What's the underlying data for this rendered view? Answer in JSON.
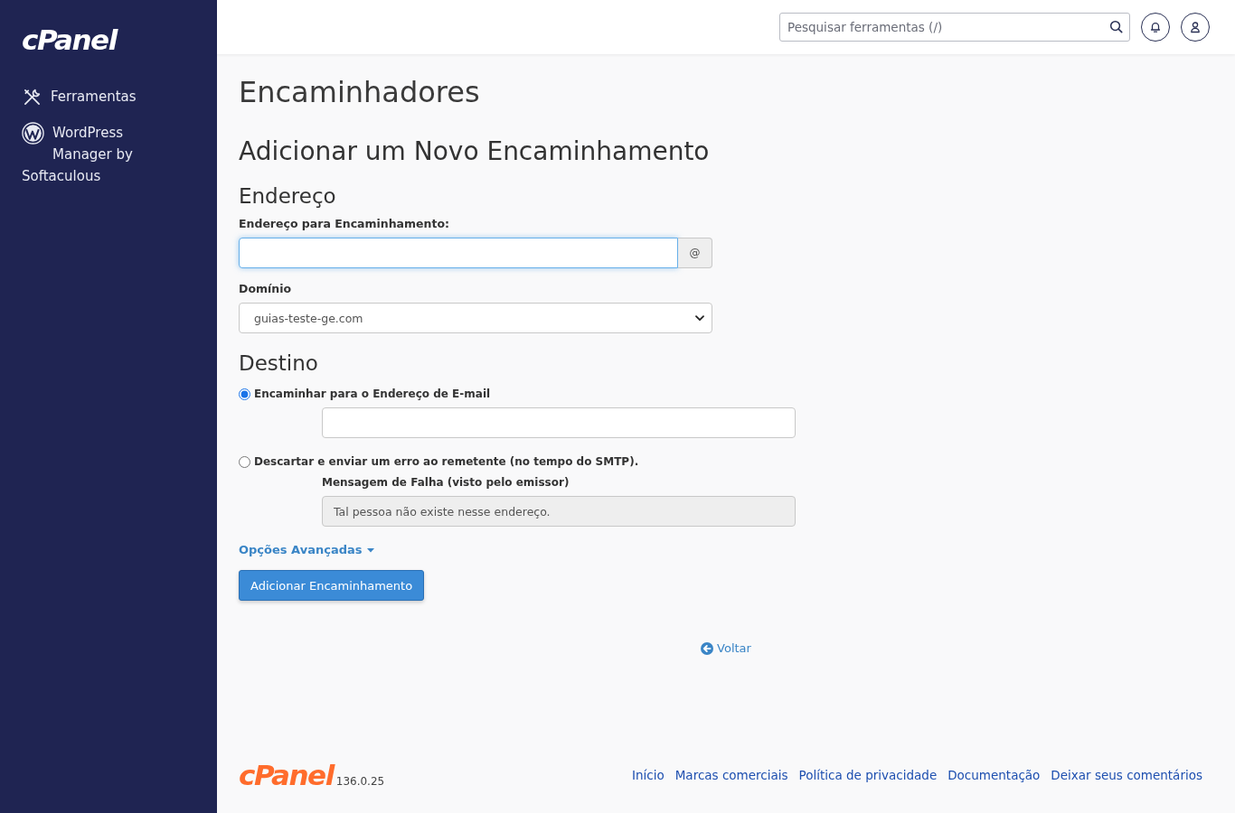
{
  "sidebar": {
    "logo": "cPanel",
    "items": [
      {
        "kind": "tools",
        "label": "Ferramentas"
      },
      {
        "kind": "wordpress",
        "label": "WordPress Manager by Softaculous"
      }
    ]
  },
  "header": {
    "search": {
      "placeholder": "Pesquisar ferramentas (/)"
    }
  },
  "page_title": "Encaminhadores",
  "form": {
    "title": "Adicionar um Novo Encaminhamento",
    "address": {
      "title": "Endereço",
      "label": "Endereço para Encaminhamento:",
      "focused": true,
      "addon": "@",
      "domain_label": "Domínio",
      "domain": "guias-teste-ge.com"
    },
    "destination": {
      "title": "Destino",
      "options": [
        {
          "kind": "forward",
          "label": "Encaminhar para o Endereço de E-mail",
          "selected": true
        },
        {
          "kind": "fail",
          "label": "Descartar e enviar um erro ao remetente (no tempo do SMTP).",
          "selected": false,
          "field_label": "Mensagem de Falha (visto pelo emissor)",
          "value": "Tal pessoa não existe nesse endereço."
        }
      ]
    },
    "advanced": {
      "label": "Opções Avançadas",
      "expanded": false
    },
    "submit": "Adicionar Encaminhamento"
  },
  "back_link": "Voltar",
  "footer": {
    "logo": "cPanel",
    "version": "136.0.25",
    "links": [
      "Início",
      "Marcas comerciais",
      "Política de privacidade",
      "Documentação",
      "Deixar seus comentários"
    ]
  }
}
